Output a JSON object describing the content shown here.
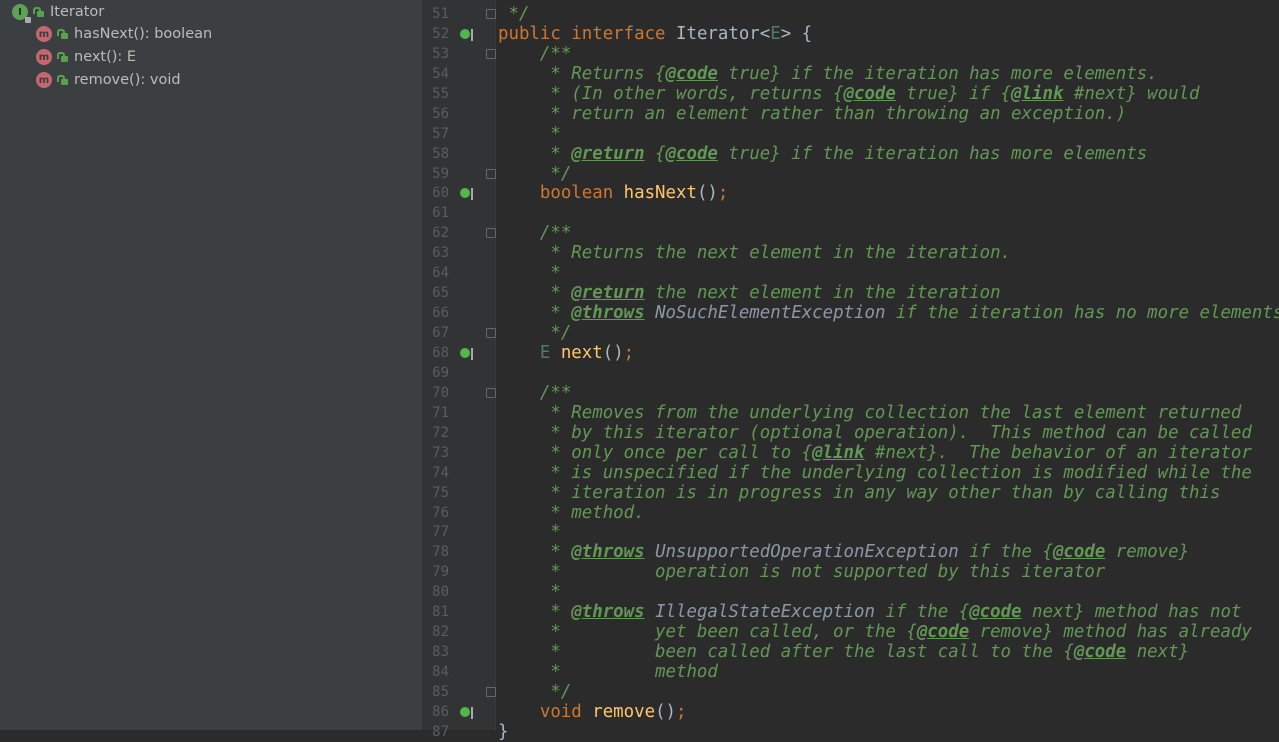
{
  "structure": {
    "root": {
      "label": "Iterator",
      "icon": "interface-icon"
    },
    "members": [
      {
        "label": "hasNext(): boolean",
        "icon": "method-icon"
      },
      {
        "label": "next(): E",
        "icon": "method-icon"
      },
      {
        "label": "remove(): void",
        "icon": "method-icon"
      }
    ]
  },
  "editor": {
    "lines": [
      {
        "num": "51",
        "fold": true,
        "segs": [
          [
            "c",
            " */"
          ]
        ]
      },
      {
        "num": "52",
        "impl": true,
        "segs": [
          [
            "k",
            "public interface "
          ],
          [
            "n",
            "Iterator<"
          ],
          [
            "tp",
            "E"
          ],
          [
            "n",
            "> {"
          ]
        ]
      },
      {
        "num": "53",
        "fold": true,
        "segs": [
          [
            "c",
            "    /**"
          ]
        ]
      },
      {
        "num": "54",
        "segs": [
          [
            "c",
            "     * Returns {"
          ],
          [
            "t",
            "@code"
          ],
          [
            "c",
            " true} if the iteration has more elements."
          ]
        ]
      },
      {
        "num": "55",
        "segs": [
          [
            "c",
            "     * (In other words, returns {"
          ],
          [
            "t",
            "@code"
          ],
          [
            "c",
            " true} if {"
          ],
          [
            "t",
            "@link"
          ],
          [
            "c",
            " #next} would"
          ]
        ]
      },
      {
        "num": "56",
        "segs": [
          [
            "c",
            "     * return an element rather than throwing an exception.)"
          ]
        ]
      },
      {
        "num": "57",
        "segs": [
          [
            "c",
            "     *"
          ]
        ]
      },
      {
        "num": "58",
        "segs": [
          [
            "c",
            "     * "
          ],
          [
            "t",
            "@return"
          ],
          [
            "c",
            " {"
          ],
          [
            "t",
            "@code"
          ],
          [
            "c",
            " true} if the iteration has more elements"
          ]
        ]
      },
      {
        "num": "59",
        "fold": true,
        "segs": [
          [
            "c",
            "     */"
          ]
        ]
      },
      {
        "num": "60",
        "impl": true,
        "segs": [
          [
            "k",
            "    boolean "
          ],
          [
            "m",
            "hasNext"
          ],
          [
            "n",
            "()"
          ],
          [
            "k",
            ";"
          ]
        ]
      },
      {
        "num": "61",
        "segs": []
      },
      {
        "num": "62",
        "fold": true,
        "segs": [
          [
            "c",
            "    /**"
          ]
        ]
      },
      {
        "num": "63",
        "segs": [
          [
            "c",
            "     * Returns the next element in the iteration."
          ]
        ]
      },
      {
        "num": "64",
        "segs": [
          [
            "c",
            "     *"
          ]
        ]
      },
      {
        "num": "65",
        "segs": [
          [
            "c",
            "     * "
          ],
          [
            "t",
            "@return"
          ],
          [
            "c",
            " the next element in the iteration"
          ]
        ]
      },
      {
        "num": "66",
        "segs": [
          [
            "c",
            "     * "
          ],
          [
            "t",
            "@throws"
          ],
          [
            "c",
            " "
          ],
          [
            "r",
            "NoSuchElementException"
          ],
          [
            "c",
            " if the iteration has no more elements"
          ]
        ]
      },
      {
        "num": "67",
        "fold": true,
        "segs": [
          [
            "c",
            "     */"
          ]
        ]
      },
      {
        "num": "68",
        "impl": true,
        "segs": [
          [
            "tp",
            "    E "
          ],
          [
            "m",
            "next"
          ],
          [
            "n",
            "()"
          ],
          [
            "k",
            ";"
          ]
        ]
      },
      {
        "num": "69",
        "segs": []
      },
      {
        "num": "70",
        "fold": true,
        "segs": [
          [
            "c",
            "    /**"
          ]
        ]
      },
      {
        "num": "71",
        "segs": [
          [
            "c",
            "     * Removes from the underlying collection the last element returned"
          ]
        ]
      },
      {
        "num": "72",
        "segs": [
          [
            "c",
            "     * by this iterator (optional operation).  This method can be called"
          ]
        ]
      },
      {
        "num": "73",
        "segs": [
          [
            "c",
            "     * only once per call to {"
          ],
          [
            "t",
            "@link"
          ],
          [
            "c",
            " #next}.  The behavior of an iterator"
          ]
        ]
      },
      {
        "num": "74",
        "segs": [
          [
            "c",
            "     * is unspecified if the underlying collection is modified while the"
          ]
        ]
      },
      {
        "num": "75",
        "segs": [
          [
            "c",
            "     * iteration is in progress in any way other than by calling this"
          ]
        ]
      },
      {
        "num": "76",
        "segs": [
          [
            "c",
            "     * method."
          ]
        ]
      },
      {
        "num": "77",
        "segs": [
          [
            "c",
            "     *"
          ]
        ]
      },
      {
        "num": "78",
        "segs": [
          [
            "c",
            "     * "
          ],
          [
            "t",
            "@throws"
          ],
          [
            "c",
            " "
          ],
          [
            "r",
            "UnsupportedOperationException"
          ],
          [
            "c",
            " if the {"
          ],
          [
            "t",
            "@code"
          ],
          [
            "c",
            " remove}"
          ]
        ]
      },
      {
        "num": "79",
        "segs": [
          [
            "c",
            "     *         operation is not supported by this iterator"
          ]
        ]
      },
      {
        "num": "80",
        "segs": [
          [
            "c",
            "     *"
          ]
        ]
      },
      {
        "num": "81",
        "segs": [
          [
            "c",
            "     * "
          ],
          [
            "t",
            "@throws"
          ],
          [
            "c",
            " "
          ],
          [
            "r",
            "IllegalStateException"
          ],
          [
            "c",
            " if the {"
          ],
          [
            "t",
            "@code"
          ],
          [
            "c",
            " next} method has not"
          ]
        ]
      },
      {
        "num": "82",
        "segs": [
          [
            "c",
            "     *         yet been called, or the {"
          ],
          [
            "t",
            "@code"
          ],
          [
            "c",
            " remove} method has already"
          ]
        ]
      },
      {
        "num": "83",
        "segs": [
          [
            "c",
            "     *         been called after the last call to the {"
          ],
          [
            "t",
            "@code"
          ],
          [
            "c",
            " next}"
          ]
        ]
      },
      {
        "num": "84",
        "segs": [
          [
            "c",
            "     *         method"
          ]
        ]
      },
      {
        "num": "85",
        "fold": true,
        "segs": [
          [
            "c",
            "     */"
          ]
        ]
      },
      {
        "num": "86",
        "impl": true,
        "segs": [
          [
            "k",
            "    void "
          ],
          [
            "m",
            "remove"
          ],
          [
            "n",
            "()"
          ],
          [
            "k",
            ";"
          ]
        ]
      },
      {
        "num": "87",
        "segs": [
          [
            "n",
            "}"
          ]
        ]
      }
    ]
  }
}
